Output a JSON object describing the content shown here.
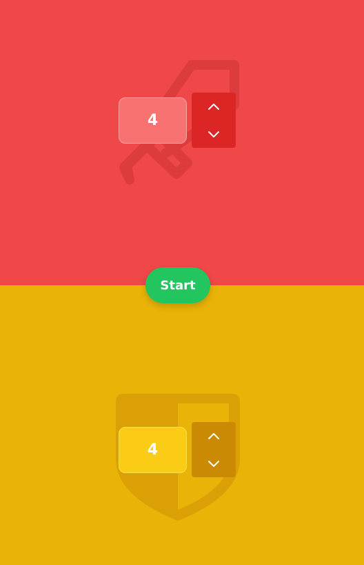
{
  "players": [
    {
      "id": "red",
      "emblem": "sword-icon",
      "value": "4",
      "colors": {
        "panel": "#f04848",
        "value_box": "#f87272",
        "stepper": "#dc2626"
      }
    },
    {
      "id": "yellow",
      "emblem": "shield-icon",
      "value": "4",
      "colors": {
        "panel": "#e9b308",
        "value_box": "#facc15",
        "stepper": "#ca8a04"
      }
    }
  ],
  "start_label": "Start",
  "start_color": "#22c55e",
  "icons": {
    "increment": "chevron-up-icon",
    "decrement": "chevron-down-icon"
  }
}
